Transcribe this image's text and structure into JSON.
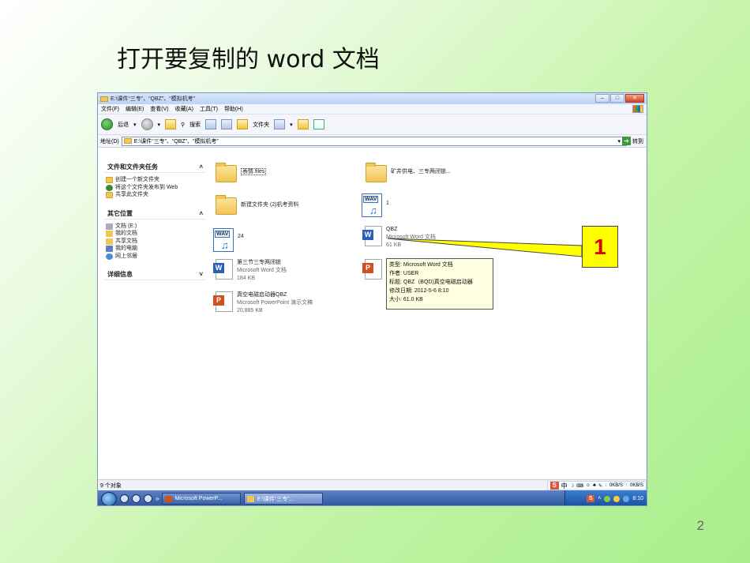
{
  "slide": {
    "title": "打开要复制的 word 文档",
    "page_number": "2"
  },
  "window": {
    "title": "E:\\课件“三专”、“QBZ”、“模拟机考”",
    "buttons": [
      "min",
      "max",
      "close"
    ]
  },
  "menubar": {
    "items": [
      "文件(F)",
      "编辑(E)",
      "查看(V)",
      "收藏(A)",
      "工具(T)",
      "帮助(H)"
    ]
  },
  "toolbar": {
    "back_label": "后退",
    "search_label": "搜索",
    "folders_label": "文件夹"
  },
  "addressbar": {
    "label": "地址(D)",
    "path": "E:\\课件“三专”、“QBZ”、“模拟机考”",
    "go_label": "转到"
  },
  "taskpane": {
    "file_tasks": {
      "header": "文件和文件夹任务",
      "items": [
        "创建一个新文件夹",
        "将这个文件夹发布到 Web",
        "共享此文件夹"
      ]
    },
    "other_places": {
      "header": "其它位置",
      "items": [
        "文档 (E:)",
        "我的文档",
        "共享文档",
        "我的电脑",
        "网上邻居"
      ]
    },
    "details": {
      "header": "详细信息"
    },
    "collapse_glyph": "≈",
    "expand_glyph": "≈"
  },
  "files": [
    {
      "name": "表情.files",
      "type": "folder"
    },
    {
      "name": "矿井供电、三专两闭锁...",
      "type": "folder"
    },
    {
      "name": "新建文件夹 (2)机考资料",
      "type": "folder"
    },
    {
      "name": "1",
      "type": "wav"
    },
    {
      "name": "24",
      "type": "wav"
    },
    {
      "name": "QBZ",
      "type": "word",
      "kind": "Microsoft Word 文档",
      "size": "61 KB"
    },
    {
      "name": "第三节三专两闭锁",
      "type": "word",
      "kind": "Microsoft Word 文档",
      "size": "184 KB"
    },
    {
      "name": "真空电磁启动器QBZ",
      "type": "ppt",
      "kind": "Microsoft PowerPoint 演示文稿",
      "size": "20,885 KB"
    }
  ],
  "tooltip": {
    "lines": [
      "类型: Microsoft Word 文档",
      "作者: USER",
      "标题: QBZ（BQD)真空电磁启动器",
      "修改日期: 2012-5-6 8:10",
      "大小: 61.0 KB"
    ]
  },
  "callout": {
    "label": "1"
  },
  "statusbar": {
    "text": "9 个对象",
    "ime_items": [
      "中",
      "0KB/S",
      "0KB/S"
    ]
  },
  "taskbar": {
    "items": [
      "Microsoft PowerP...",
      "E:\\课件“三专”..."
    ],
    "clock": "8:10"
  }
}
